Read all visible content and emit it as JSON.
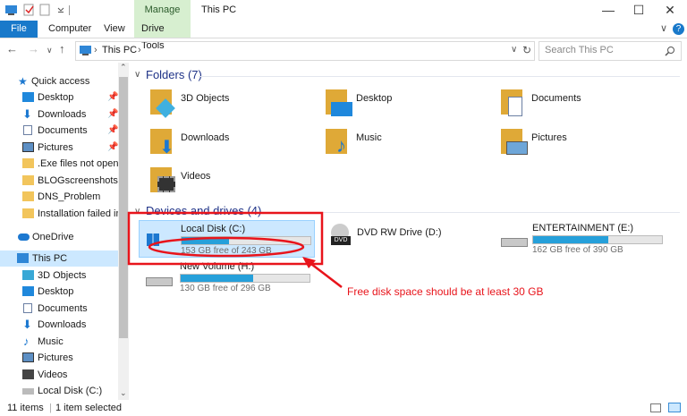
{
  "window": {
    "manage_tab": "Manage",
    "title": "This PC",
    "minimize": "—",
    "maximize": "☐",
    "close": "✕"
  },
  "ribbon": {
    "tabs": [
      "File",
      "Computer",
      "View",
      "Drive Tools"
    ]
  },
  "address": {
    "path": "This PC",
    "search_placeholder": "Search This PC"
  },
  "sidebar": {
    "quick_access": "Quick access",
    "quick_items": [
      "Desktop",
      "Downloads",
      "Documents",
      "Pictures",
      ".Exe files not opening",
      "BLOGscreenshots",
      "DNS_Problem",
      "Installation failed in th"
    ],
    "onedrive": "OneDrive",
    "this_pc": "This PC",
    "pc_items": [
      "3D Objects",
      "Desktop",
      "Documents",
      "Downloads",
      "Music",
      "Pictures",
      "Videos",
      "Local Disk (C:)"
    ]
  },
  "folders": {
    "header": "Folders (7)",
    "items": [
      "3D Objects",
      "Desktop",
      "Documents",
      "Downloads",
      "Music",
      "Pictures",
      "Videos"
    ]
  },
  "devices": {
    "header": "Devices and drives (4)",
    "drives": [
      {
        "name": "Local Disk (C:)",
        "free_text": "153 GB free of 243 GB",
        "used_fraction": 0.37
      },
      {
        "name": "DVD RW Drive (D:)"
      },
      {
        "name": "ENTERTAINMENT (E:)",
        "free_text": "162 GB free of 390 GB",
        "used_fraction": 0.58
      },
      {
        "name": "New Volume (H:)",
        "free_text": "130 GB free of 296 GB",
        "used_fraction": 0.56
      }
    ]
  },
  "annotation": {
    "text": "Free disk space should be at least 30 GB",
    "color": "#e8141b"
  },
  "status": {
    "items": "11 items",
    "selected": "1 item selected"
  }
}
